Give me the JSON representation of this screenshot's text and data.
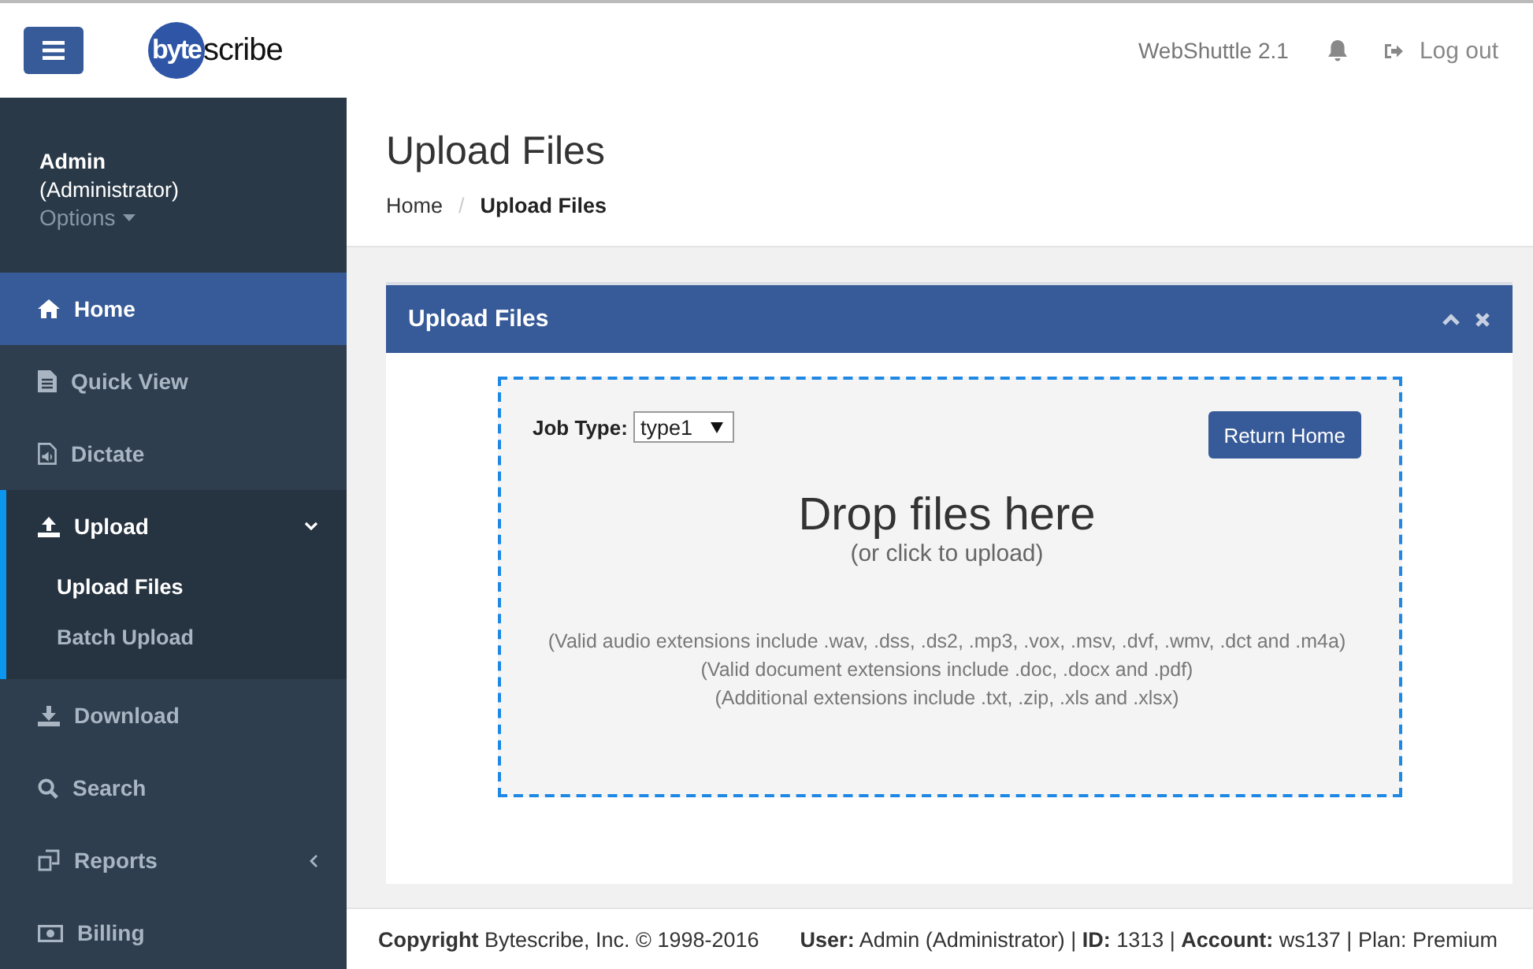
{
  "header": {
    "logo": {
      "mark": "byte",
      "rest": "scribe"
    },
    "app_version": "WebShuttle 2.1",
    "logout": "Log out"
  },
  "user": {
    "name": "Admin",
    "role": "(Administrator)",
    "options": "Options"
  },
  "sidebar": {
    "items": [
      {
        "label": "Home",
        "selected": true,
        "expanded": false,
        "has_submenu": false
      },
      {
        "label": "Quick View",
        "selected": false,
        "expanded": false,
        "has_submenu": false
      },
      {
        "label": "Dictate",
        "selected": false,
        "expanded": false,
        "has_submenu": false
      },
      {
        "label": "Upload",
        "selected": false,
        "expanded": true,
        "has_submenu": true,
        "children": [
          {
            "label": "Upload Files",
            "selected": true
          },
          {
            "label": "Batch Upload",
            "selected": false
          }
        ]
      },
      {
        "label": "Download",
        "selected": false,
        "expanded": false,
        "has_submenu": false
      },
      {
        "label": "Search",
        "selected": false,
        "expanded": false,
        "has_submenu": false
      },
      {
        "label": "Reports",
        "selected": false,
        "expanded": false,
        "has_submenu": true
      },
      {
        "label": "Billing",
        "selected": false,
        "expanded": false,
        "has_submenu": false
      }
    ]
  },
  "page": {
    "title": "Upload Files",
    "breadcrumb": [
      {
        "label": "Home",
        "selected": false
      },
      {
        "label": "Upload Files",
        "selected": true
      }
    ],
    "separator": "/"
  },
  "panel": {
    "title": "Upload Files",
    "job_type_label": "Job Type:",
    "job_type_value": "type1",
    "return_button": "Return Home",
    "drop_title": "Drop files here",
    "drop_subtitle": "(or click to upload)",
    "notes": [
      "(Valid audio extensions include .wav, .dss, .ds2, .mp3, .vox, .msv, .dvf, .wmv, .dct and .m4a)",
      "(Valid document extensions include .doc, .docx and .pdf)",
      "(Additional extensions include .txt, .zip, .xls and .xlsx)"
    ]
  },
  "footer": {
    "copyright": "**Copyright** Bytescribe, Inc. © 1998-2016",
    "info": "**User:** Admin (Administrator) | **ID:** 1313 | **Account:** ws137 | Plan: Premium"
  }
}
